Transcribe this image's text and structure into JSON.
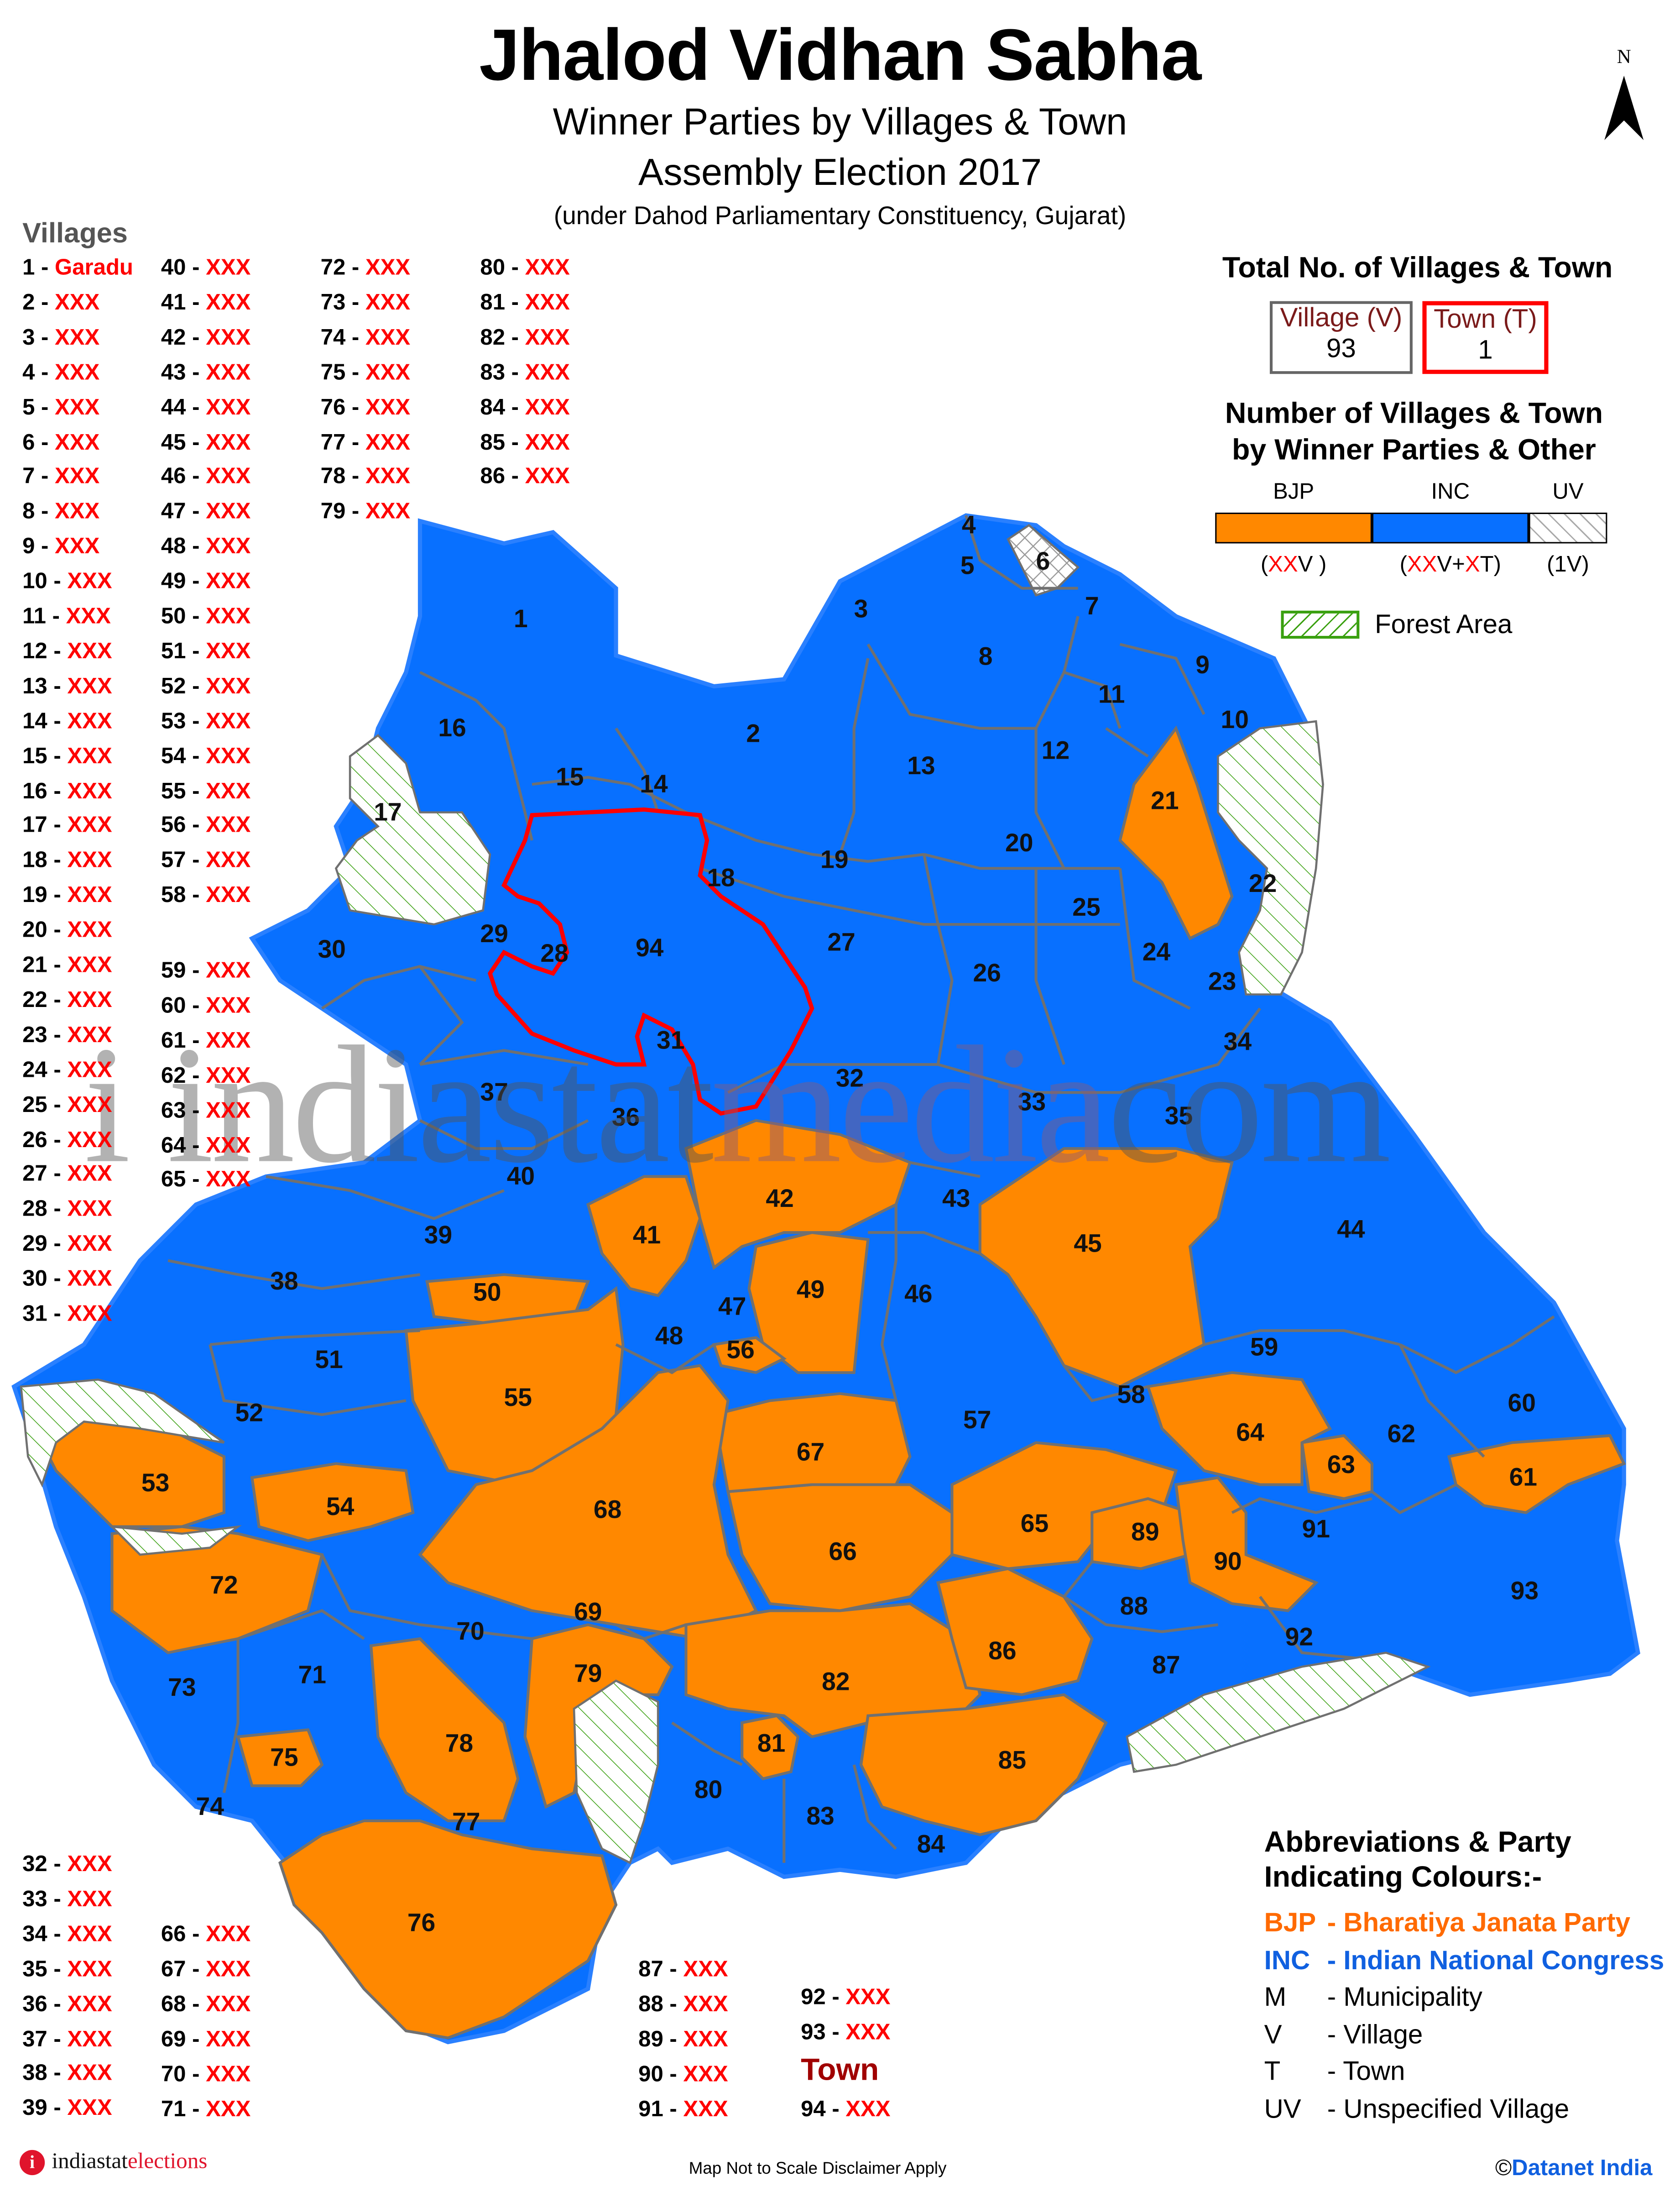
{
  "header": {
    "title": "Jhalod Vidhan Sabha",
    "subtitle1": "Winner Parties by Villages & Town",
    "subtitle2": "Assembly Election 2017",
    "subtitle3": "(under Dahod Parliamentary Constituency, Gujarat)"
  },
  "north_arrow": {
    "label": "N",
    "icon": "north-arrow-icon"
  },
  "villages_heading": "Villages",
  "village_list": {
    "col1": [
      [
        "1",
        "Garadu"
      ],
      [
        "2",
        "XXX"
      ],
      [
        "3",
        "XXX"
      ],
      [
        "4",
        "XXX"
      ],
      [
        "5",
        "XXX"
      ],
      [
        "6",
        "XXX"
      ],
      [
        "7",
        "XXX"
      ],
      [
        "8",
        "XXX"
      ],
      [
        "9",
        "XXX"
      ],
      [
        "10",
        "XXX"
      ],
      [
        "11",
        "XXX"
      ],
      [
        "12",
        "XXX"
      ],
      [
        "13",
        "XXX"
      ],
      [
        "14",
        "XXX"
      ],
      [
        "15",
        "XXX"
      ],
      [
        "16",
        "XXX"
      ],
      [
        "17",
        "XXX"
      ],
      [
        "18",
        "XXX"
      ],
      [
        "19",
        "XXX"
      ],
      [
        "20",
        "XXX"
      ],
      [
        "21",
        "XXX"
      ],
      [
        "22",
        "XXX"
      ],
      [
        "23",
        "XXX"
      ],
      [
        "24",
        "XXX"
      ],
      [
        "25",
        "XXX"
      ],
      [
        "26",
        "XXX"
      ],
      [
        "27",
        "XXX"
      ],
      [
        "28",
        "XXX"
      ],
      [
        "29",
        "XXX"
      ],
      [
        "30",
        "XXX"
      ],
      [
        "31",
        "XXX"
      ]
    ],
    "col2": [
      [
        "40",
        "XXX"
      ],
      [
        "41",
        "XXX"
      ],
      [
        "42",
        "XXX"
      ],
      [
        "43",
        "XXX"
      ],
      [
        "44",
        "XXX"
      ],
      [
        "45",
        "XXX"
      ],
      [
        "46",
        "XXX"
      ],
      [
        "47",
        "XXX"
      ],
      [
        "48",
        "XXX"
      ],
      [
        "49",
        "XXX"
      ],
      [
        "50",
        "XXX"
      ],
      [
        "51",
        "XXX"
      ],
      [
        "52",
        "XXX"
      ],
      [
        "53",
        "XXX"
      ],
      [
        "54",
        "XXX"
      ],
      [
        "55",
        "XXX"
      ],
      [
        "56",
        "XXX"
      ],
      [
        "57",
        "XXX"
      ],
      [
        "58",
        "XXX"
      ]
    ],
    "col2b": [
      [
        "59",
        "XXX"
      ],
      [
        "60",
        "XXX"
      ],
      [
        "61",
        "XXX"
      ],
      [
        "62",
        "XXX"
      ],
      [
        "63",
        "XXX"
      ],
      [
        "64",
        "XXX"
      ],
      [
        "65",
        "XXX"
      ]
    ],
    "col3": [
      [
        "72",
        "XXX"
      ],
      [
        "73",
        "XXX"
      ],
      [
        "74",
        "XXX"
      ],
      [
        "75",
        "XXX"
      ],
      [
        "76",
        "XXX"
      ],
      [
        "77",
        "XXX"
      ],
      [
        "78",
        "XXX"
      ],
      [
        "79",
        "XXX"
      ]
    ],
    "col4": [
      [
        "80",
        "XXX"
      ],
      [
        "81",
        "XXX"
      ],
      [
        "82",
        "XXX"
      ],
      [
        "83",
        "XXX"
      ],
      [
        "84",
        "XXX"
      ],
      [
        "85",
        "XXX"
      ],
      [
        "86",
        "XXX"
      ]
    ],
    "bottom_col1": [
      [
        "32",
        "XXX"
      ],
      [
        "33",
        "XXX"
      ],
      [
        "34",
        "XXX"
      ],
      [
        "35",
        "XXX"
      ],
      [
        "36",
        "XXX"
      ],
      [
        "37",
        "XXX"
      ],
      [
        "38",
        "XXX"
      ],
      [
        "39",
        "XXX"
      ]
    ],
    "bottom_col2": [
      [
        "66",
        "XXX"
      ],
      [
        "67",
        "XXX"
      ],
      [
        "68",
        "XXX"
      ],
      [
        "69",
        "XXX"
      ],
      [
        "70",
        "XXX"
      ],
      [
        "71",
        "XXX"
      ]
    ],
    "bottom_col3": [
      [
        "87",
        "XXX"
      ],
      [
        "88",
        "XXX"
      ],
      [
        "89",
        "XXX"
      ],
      [
        "90",
        "XXX"
      ],
      [
        "91",
        "XXX"
      ]
    ],
    "bottom_col4": [
      [
        "92",
        "XXX"
      ],
      [
        "93",
        "XXX"
      ]
    ],
    "town_heading": "Town",
    "town": [
      [
        "94",
        "XXX"
      ]
    ]
  },
  "totals": {
    "heading": "Total No. of Villages & Town",
    "village_label": "Village (V)",
    "village_count": "93",
    "town_label": "Town (T)",
    "town_count": "1"
  },
  "party_bar": {
    "heading_line1": "Number of Villages & Town",
    "heading_line2": "by Winner Parties & Other",
    "segments": [
      {
        "label": "BJP",
        "color": "#ff8800",
        "count_parts": [
          [
            "(",
            ""
          ],
          [
            "XX",
            "red"
          ],
          [
            "V )",
            ""
          ]
        ]
      },
      {
        "label": "INC",
        "color": "#0870ff",
        "count_parts": [
          [
            "(",
            ""
          ],
          [
            "XX",
            "red"
          ],
          [
            "V+",
            ""
          ],
          [
            "X",
            "red"
          ],
          [
            "T)",
            ""
          ]
        ]
      },
      {
        "label": "UV",
        "color": "#ffffff",
        "count_parts": [
          [
            "(1V)",
            ""
          ]
        ]
      }
    ]
  },
  "forest_legend": "Forest Area",
  "abbreviations": {
    "heading_line1": "Abbreviations & Party",
    "heading_line2": "Indicating Colours:-",
    "items": [
      {
        "key": "BJP",
        "value": "- Bharatiya Janata Party",
        "color": "#ff6a00"
      },
      {
        "key": "INC",
        "value": "- Indian National Congress",
        "color": "#1060e0"
      },
      {
        "key": "M",
        "value": "-  Municipality",
        "color": "#000000"
      },
      {
        "key": "V",
        "value": "- Village",
        "color": "#000000"
      },
      {
        "key": "T",
        "value": "-  Town",
        "color": "#000000"
      },
      {
        "key": "UV",
        "value": "-  Unspecified Village",
        "color": "#000000"
      }
    ]
  },
  "colors": {
    "bjp": "#ff8800",
    "inc": "#0870ff",
    "town_border": "#ff0000",
    "forest": "#3aa010"
  },
  "map": {
    "regions": [
      {
        "id": "1",
        "party": "INC"
      },
      {
        "id": "2",
        "party": "INC"
      },
      {
        "id": "3",
        "party": "INC"
      },
      {
        "id": "4",
        "party": "INC"
      },
      {
        "id": "5",
        "party": "INC"
      },
      {
        "id": "6",
        "party": "UV"
      },
      {
        "id": "7",
        "party": "INC"
      },
      {
        "id": "8",
        "party": "INC"
      },
      {
        "id": "9",
        "party": "INC"
      },
      {
        "id": "10",
        "party": "INC"
      },
      {
        "id": "11",
        "party": "INC"
      },
      {
        "id": "12",
        "party": "INC"
      },
      {
        "id": "13",
        "party": "INC"
      },
      {
        "id": "14",
        "party": "INC"
      },
      {
        "id": "15",
        "party": "INC"
      },
      {
        "id": "16",
        "party": "INC"
      },
      {
        "id": "17",
        "party": "INC"
      },
      {
        "id": "18",
        "party": "INC"
      },
      {
        "id": "19",
        "party": "INC"
      },
      {
        "id": "20",
        "party": "INC"
      },
      {
        "id": "21",
        "party": "BJP"
      },
      {
        "id": "22",
        "party": "INC"
      },
      {
        "id": "23",
        "party": "INC"
      },
      {
        "id": "24",
        "party": "INC"
      },
      {
        "id": "25",
        "party": "INC"
      },
      {
        "id": "26",
        "party": "INC"
      },
      {
        "id": "27",
        "party": "INC"
      },
      {
        "id": "28",
        "party": "INC"
      },
      {
        "id": "29",
        "party": "INC"
      },
      {
        "id": "30",
        "party": "INC"
      },
      {
        "id": "31",
        "party": "INC"
      },
      {
        "id": "32",
        "party": "INC"
      },
      {
        "id": "33",
        "party": "INC"
      },
      {
        "id": "34",
        "party": "INC"
      },
      {
        "id": "35",
        "party": "INC"
      },
      {
        "id": "36",
        "party": "INC"
      },
      {
        "id": "37",
        "party": "INC"
      },
      {
        "id": "38",
        "party": "INC"
      },
      {
        "id": "39",
        "party": "INC"
      },
      {
        "id": "40",
        "party": "INC"
      },
      {
        "id": "41",
        "party": "BJP"
      },
      {
        "id": "42",
        "party": "BJP"
      },
      {
        "id": "43",
        "party": "INC"
      },
      {
        "id": "44",
        "party": "INC"
      },
      {
        "id": "45",
        "party": "BJP"
      },
      {
        "id": "46",
        "party": "INC"
      },
      {
        "id": "47",
        "party": "INC"
      },
      {
        "id": "48",
        "party": "INC"
      },
      {
        "id": "49",
        "party": "BJP"
      },
      {
        "id": "50",
        "party": "BJP"
      },
      {
        "id": "51",
        "party": "INC"
      },
      {
        "id": "52",
        "party": "INC"
      },
      {
        "id": "53",
        "party": "BJP"
      },
      {
        "id": "54",
        "party": "BJP"
      },
      {
        "id": "55",
        "party": "BJP"
      },
      {
        "id": "56",
        "party": "BJP"
      },
      {
        "id": "57",
        "party": "INC"
      },
      {
        "id": "58",
        "party": "INC"
      },
      {
        "id": "59",
        "party": "INC"
      },
      {
        "id": "60",
        "party": "INC"
      },
      {
        "id": "61",
        "party": "BJP"
      },
      {
        "id": "62",
        "party": "INC"
      },
      {
        "id": "63",
        "party": "BJP"
      },
      {
        "id": "64",
        "party": "BJP"
      },
      {
        "id": "65",
        "party": "BJP"
      },
      {
        "id": "66",
        "party": "BJP"
      },
      {
        "id": "67",
        "party": "BJP"
      },
      {
        "id": "68",
        "party": "BJP"
      },
      {
        "id": "69",
        "party": "INC"
      },
      {
        "id": "70",
        "party": "INC"
      },
      {
        "id": "71",
        "party": "INC"
      },
      {
        "id": "72",
        "party": "BJP"
      },
      {
        "id": "73",
        "party": "INC"
      },
      {
        "id": "74",
        "party": "INC"
      },
      {
        "id": "75",
        "party": "BJP"
      },
      {
        "id": "76",
        "party": "BJP"
      },
      {
        "id": "77",
        "party": "INC"
      },
      {
        "id": "78",
        "party": "BJP"
      },
      {
        "id": "79",
        "party": "BJP"
      },
      {
        "id": "80",
        "party": "INC"
      },
      {
        "id": "81",
        "party": "BJP"
      },
      {
        "id": "82",
        "party": "BJP"
      },
      {
        "id": "83",
        "party": "INC"
      },
      {
        "id": "84",
        "party": "INC"
      },
      {
        "id": "85",
        "party": "BJP"
      },
      {
        "id": "86",
        "party": "BJP"
      },
      {
        "id": "87",
        "party": "INC"
      },
      {
        "id": "88",
        "party": "INC"
      },
      {
        "id": "89",
        "party": "BJP"
      },
      {
        "id": "90",
        "party": "BJP"
      },
      {
        "id": "91",
        "party": "INC"
      },
      {
        "id": "92",
        "party": "INC"
      },
      {
        "id": "93",
        "party": "INC"
      },
      {
        "id": "94",
        "party": "INC",
        "town": true
      }
    ]
  },
  "watermark": {
    "part1": "i indiastat",
    "part2": "media",
    "part3": "com"
  },
  "footer": {
    "logo_part1": "indiastat",
    "logo_part2": "elections",
    "map_note": "Map Not to Scale   Disclaimer Apply",
    "copyright_symbol": "©",
    "copyright": "Datanet India"
  }
}
